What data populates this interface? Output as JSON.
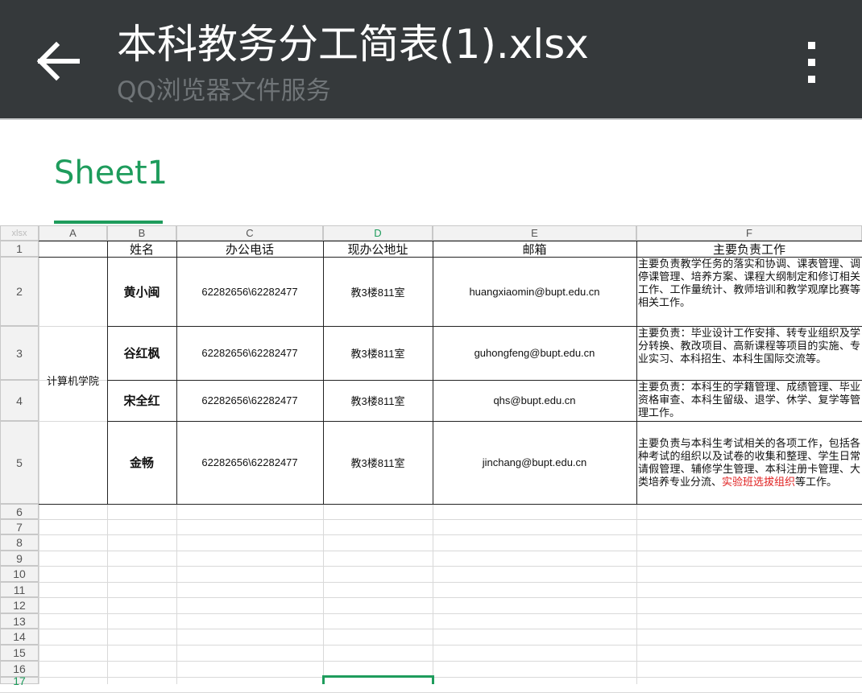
{
  "appbar": {
    "title": "本科教务分工简表(1).xlsx",
    "subtitle": "QQ浏览器文件服务",
    "back_icon": "arrow-left",
    "more_icon": "three-dots-vertical"
  },
  "tab": {
    "label": "Sheet1"
  },
  "sheet": {
    "corner": "xlsx",
    "columns": [
      "A",
      "B",
      "C",
      "D",
      "E",
      "F"
    ],
    "selected_column": "D",
    "row_numbers": [
      "1",
      "2",
      "3",
      "4",
      "5",
      "6",
      "7",
      "8",
      "9",
      "10",
      "11",
      "12",
      "13",
      "14",
      "15",
      "16",
      "17"
    ],
    "headers": {
      "name": "姓名",
      "phone": "办公电话",
      "address": "现办公地址",
      "email": "邮箱",
      "duty": "主要负责工作"
    },
    "department": "计算机学院",
    "rows": [
      {
        "name": "黄小闽",
        "phone": "62282656\\62282477",
        "address": "教3楼811室",
        "email": "huangxiaomin@bupt.edu.cn",
        "duty": "主要负责教学任务的落实和协调、课表管理、调停课管理、培养方案、课程大纲制定和修订相关工作、工作量统计、教师培训和教学观摩比赛等相关工作。"
      },
      {
        "name": "谷红枫",
        "phone": "62282656\\62282477",
        "address": "教3楼811室",
        "email": "guhongfeng@bupt.edu.cn",
        "duty": "主要负责：毕业设计工作安排、转专业组织及学分转换、教改项目、高新课程等项目的实施、专业实习、本科招生、本科生国际交流等。"
      },
      {
        "name": "宋全红",
        "phone": "62282656\\62282477",
        "address": "教3楼811室",
        "email": "qhs@bupt.edu.cn",
        "duty": "主要负责：本科生的学籍管理、成绩管理、毕业资格审查、本科生留级、退学、休学、复学等管理工作。"
      },
      {
        "name": "金畅",
        "phone": "62282656\\62282477",
        "address": "教3楼811室",
        "email": "jinchang@bupt.edu.cn",
        "duty_before": "主要负责与本科生考试相关的各项工作，包括各种考试的组织以及试卷的收集和整理、学生日常请假管理、辅修学生管理、本科注册卡管理、大类培养专业分流、",
        "duty_highlight": "实验班选拔组织",
        "duty_after": "等工作。"
      }
    ],
    "colors": {
      "accent": "#1e9c5c",
      "highlight_text": "#e02020",
      "appbar": "#35393b"
    }
  }
}
